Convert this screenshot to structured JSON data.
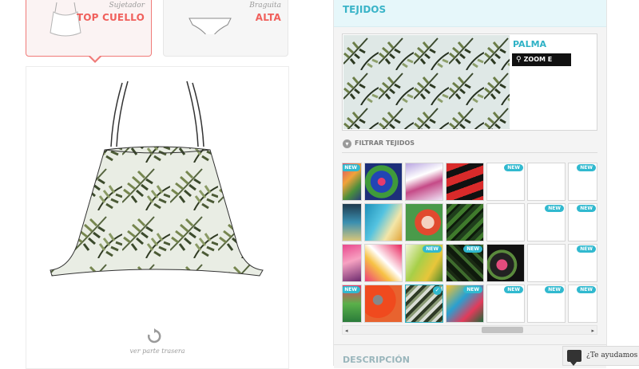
{
  "pieces": [
    {
      "caption": "Sujetador",
      "value": "TOP CUELLO",
      "selected": true,
      "icon": "halter-top-icon"
    },
    {
      "caption": "Braguita",
      "value": "ALTA",
      "selected": false,
      "icon": "high-waist-bottom-icon"
    }
  ],
  "preview": {
    "rear_label": "ver parte trasera",
    "rotate_icon": "rotate-icon"
  },
  "fabrics_panel": {
    "title": "TEJIDOS",
    "selected_fabric": {
      "name": "PALMA",
      "zoom_label": "ZOOM E INFO"
    },
    "filter_label": "FILTRAR TEJIDOS",
    "description_label": "DESCRIPCIÓN",
    "new_label": "NEW"
  },
  "help": {
    "label": "¿Te ayudamos"
  },
  "colors": {
    "accent": "#31b9cf",
    "selected": "#f0605c",
    "panel": "#f4f4f4"
  }
}
